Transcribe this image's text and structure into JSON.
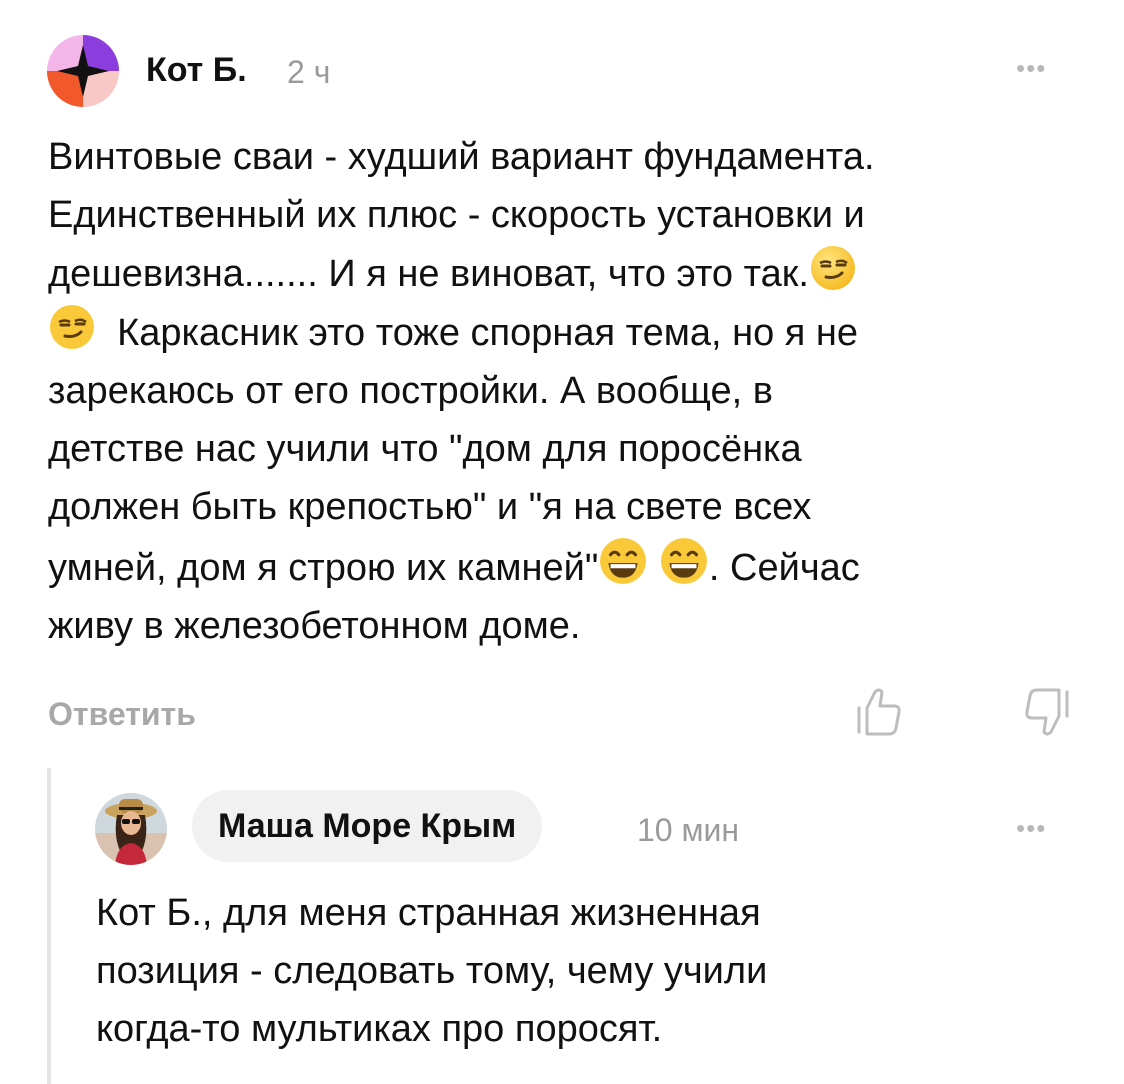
{
  "comment": {
    "author": "Кот Б.",
    "time": "2 ч",
    "more_label": "•••",
    "lines": [
      "Винтовые сваи - худший вариант фундамента.",
      "Единственный их плюс - скорость установки и",
      "дешевизна....... И я не виноват, что это так.",
      "Каркасник это тоже спорная тема, но я не",
      "зарекаюсь от его постройки. А вообще, в",
      "детстве нас учили что \"дом для поросёнка",
      "должен быть крепостью\" и \"я на свете всех",
      "умней, дом я строю их камней\"",
      ". Сейчас",
      "живу в железобетонном доме."
    ],
    "emoji_smirk": "smirking-face",
    "emoji_grin": "grinning-face-with-smiling-eyes",
    "reply_label": "Ответить",
    "like_icon": "thumbs-up-icon",
    "dislike_icon": "thumbs-down-icon"
  },
  "reply": {
    "author": "Маша Море Крым",
    "time": "10 мин",
    "more_label": "•••",
    "lines": [
      "Кот Б., для меня странная  жизненная",
      "позиция - следовать тому, чему учили",
      "когда-то мультиках про поросят."
    ]
  }
}
